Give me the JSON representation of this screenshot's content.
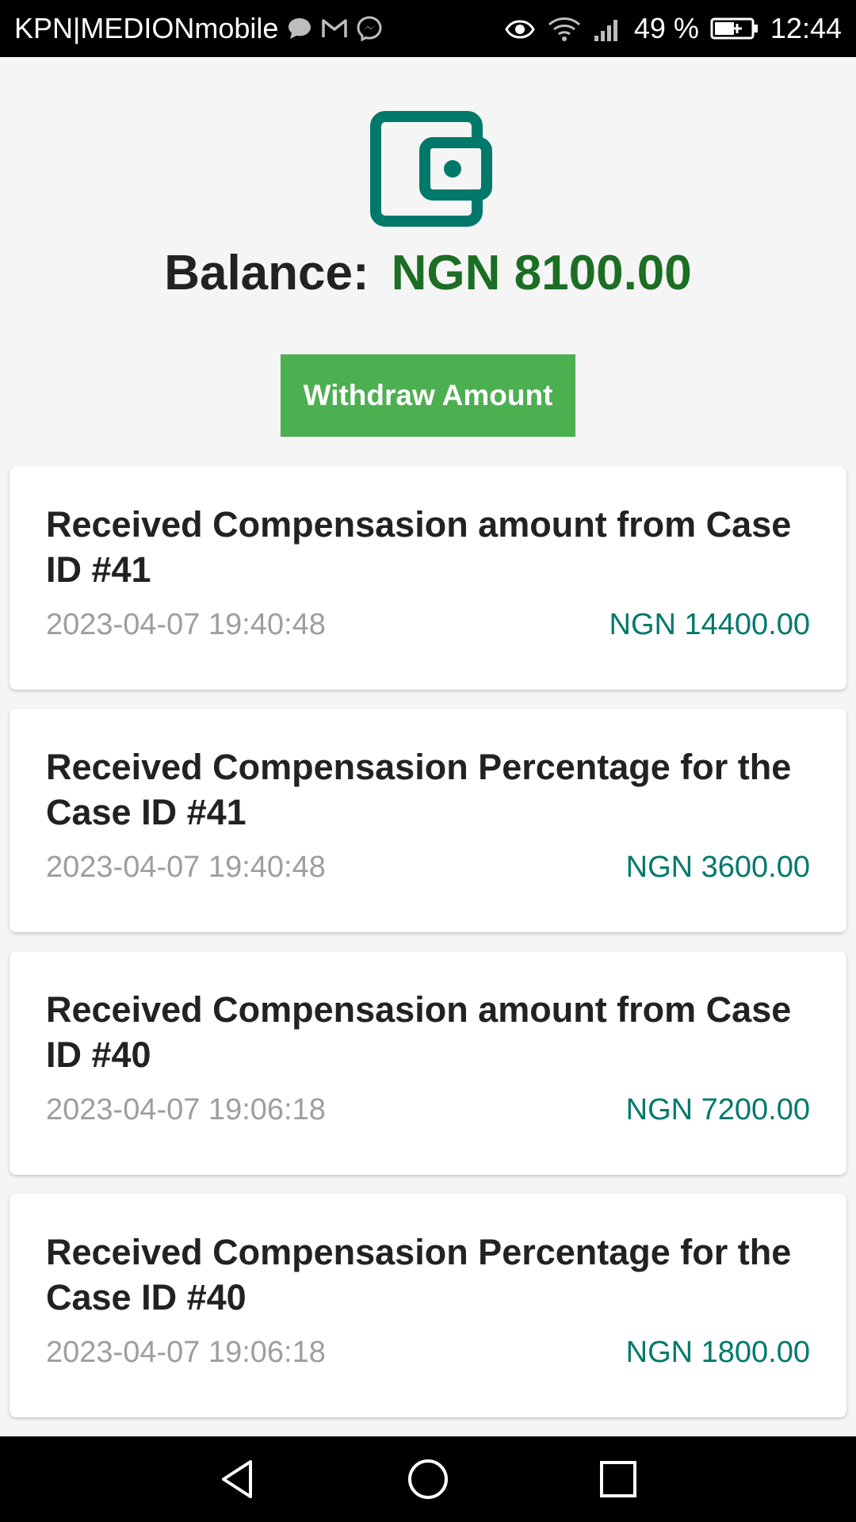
{
  "status_bar": {
    "carrier": "KPN|MEDIONmobile",
    "left_icons": [
      "chat-bubble-icon",
      "gmail-icon",
      "messenger-icon"
    ],
    "right_icons": [
      "eye-icon",
      "wifi-icon",
      "signal-icon"
    ],
    "battery_percent": "49 %",
    "time": "12:44"
  },
  "wallet": {
    "icon": "wallet-icon",
    "balance_label": "Balance:",
    "balance_value": "NGN 8100.00",
    "withdraw_label": "Withdraw Amount"
  },
  "transactions": [
    {
      "title": "Received Compensasion amount from Case ID #41",
      "date": "2023-04-07 19:40:48",
      "amount": "NGN 14400.00"
    },
    {
      "title": "Received Compensasion Percentage for the Case ID #41",
      "date": "2023-04-07 19:40:48",
      "amount": "NGN 3600.00"
    },
    {
      "title": "Received Compensasion amount from Case ID #40",
      "date": "2023-04-07 19:06:18",
      "amount": "NGN 7200.00"
    },
    {
      "title": "Received Compensasion Percentage for the Case ID #40",
      "date": "2023-04-07 19:06:18",
      "amount": "NGN 1800.00"
    }
  ],
  "nav_bar": {
    "buttons": [
      "back-icon",
      "home-icon",
      "recents-icon"
    ]
  },
  "colors": {
    "accent_green": "#4caf50",
    "balance_green": "#1b6e23",
    "amount_teal": "#00796b",
    "wallet_teal": "#00796b"
  }
}
